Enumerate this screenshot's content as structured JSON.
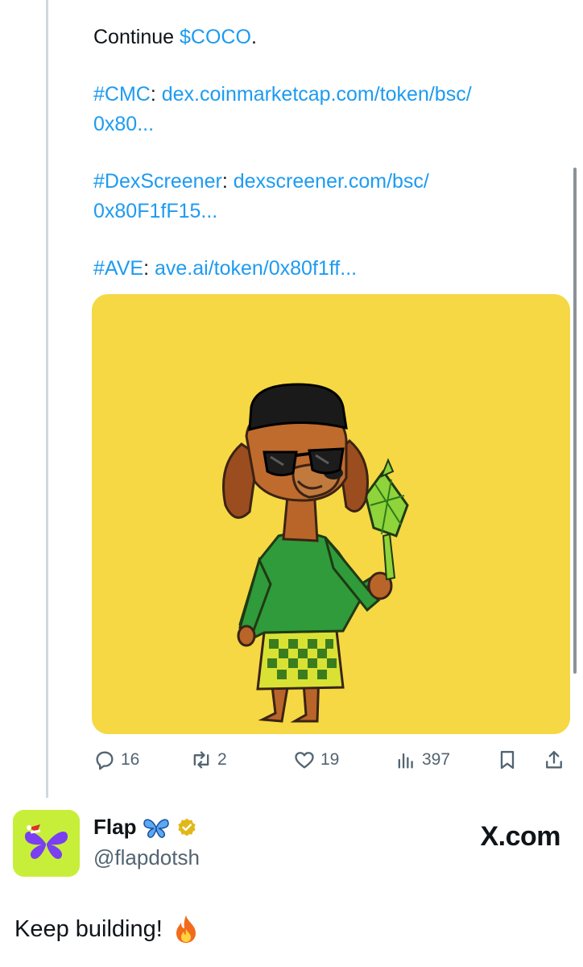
{
  "tweet": {
    "line1": {
      "text": "Continue ",
      "cashtag": "$COCO",
      "suffix": "."
    },
    "links": [
      {
        "tag": "#CMC",
        "sep": ": ",
        "url_line1": "dex.coinmarketcap.com/token/bsc/",
        "url_line2": "0x80..."
      },
      {
        "tag": "#DexScreener",
        "sep": ": ",
        "url_line1": "dexscreener.com/bsc/",
        "url_line2": "0x80F1fF15..."
      },
      {
        "tag": "#AVE",
        "sep": ": ",
        "url_line1": "ave.ai/token/0x80f1ff...",
        "url_line2": ""
      }
    ],
    "image": {
      "background": "#f5d844",
      "subject": "cartoon dog in songkok, sunglasses, green baju melayu holding ketupat"
    }
  },
  "actions": {
    "replies": "16",
    "reposts": "2",
    "likes": "19",
    "views": "397"
  },
  "author": {
    "name": "Flap",
    "handle": "@flapdotsh",
    "badges": [
      "butterfly-emoji",
      "verified-gold-badge"
    ],
    "avatar_bg": "#c7ef3a"
  },
  "source_label": "X.com",
  "reply": {
    "text": "Keep building!",
    "emoji": "fire-emoji"
  },
  "colors": {
    "link": "#1d9bf0",
    "muted": "#536471",
    "text": "#0f1419"
  }
}
